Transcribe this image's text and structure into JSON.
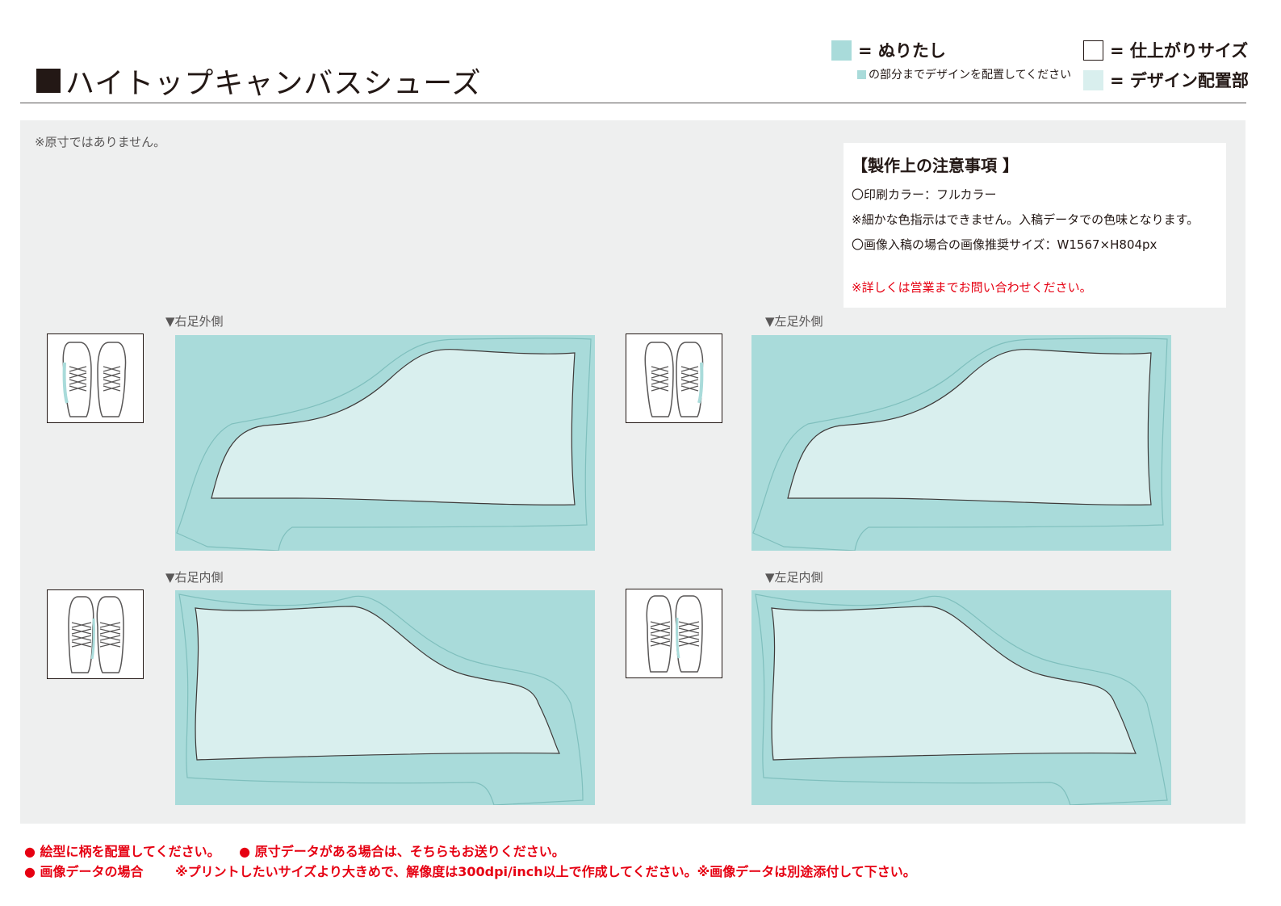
{
  "header": {
    "title": "ハイトップキャンバスシューズ"
  },
  "legend": {
    "bleed_label": "= ぬりたし",
    "bleed_note": "の部分までデザインを配置してください",
    "finish_label": "= 仕上がりサイズ",
    "design_label": "= デザイン配置部",
    "colors": {
      "bleed": "#a9dbda",
      "design": "#d9efee",
      "finish": "#ffffff"
    }
  },
  "canvas": {
    "scale_note": "※原寸ではありません。",
    "background": "#eeefef"
  },
  "notes": {
    "title": "【製作上の注意事項 】",
    "lines": [
      "〇印刷カラー：フルカラー",
      "※細かな色指示はできません。入稿データでの色味となります。",
      "〇画像入稿の場合の画像推奨サイズ：W1567×H804px"
    ],
    "red_note": "※詳しくは営業までお問い合わせください。"
  },
  "sections": {
    "right_outer": "▼右足外側",
    "left_outer": "▼左足外側",
    "right_inner": "▼右足内側",
    "left_inner": "▼左足内側"
  },
  "footer": {
    "line1_a": "● 絵型に柄を配置してください。",
    "line1_b": "● 原寸データがある場合は、そちらもお送りください。",
    "line2_a": "● 画像データの場合",
    "line2_b": "※プリントしたいサイズより大きめで、解像度は300dpi/inch以上で作成してください。※画像データは別途添付して下さい。",
    "accent_color": "#e60012"
  }
}
